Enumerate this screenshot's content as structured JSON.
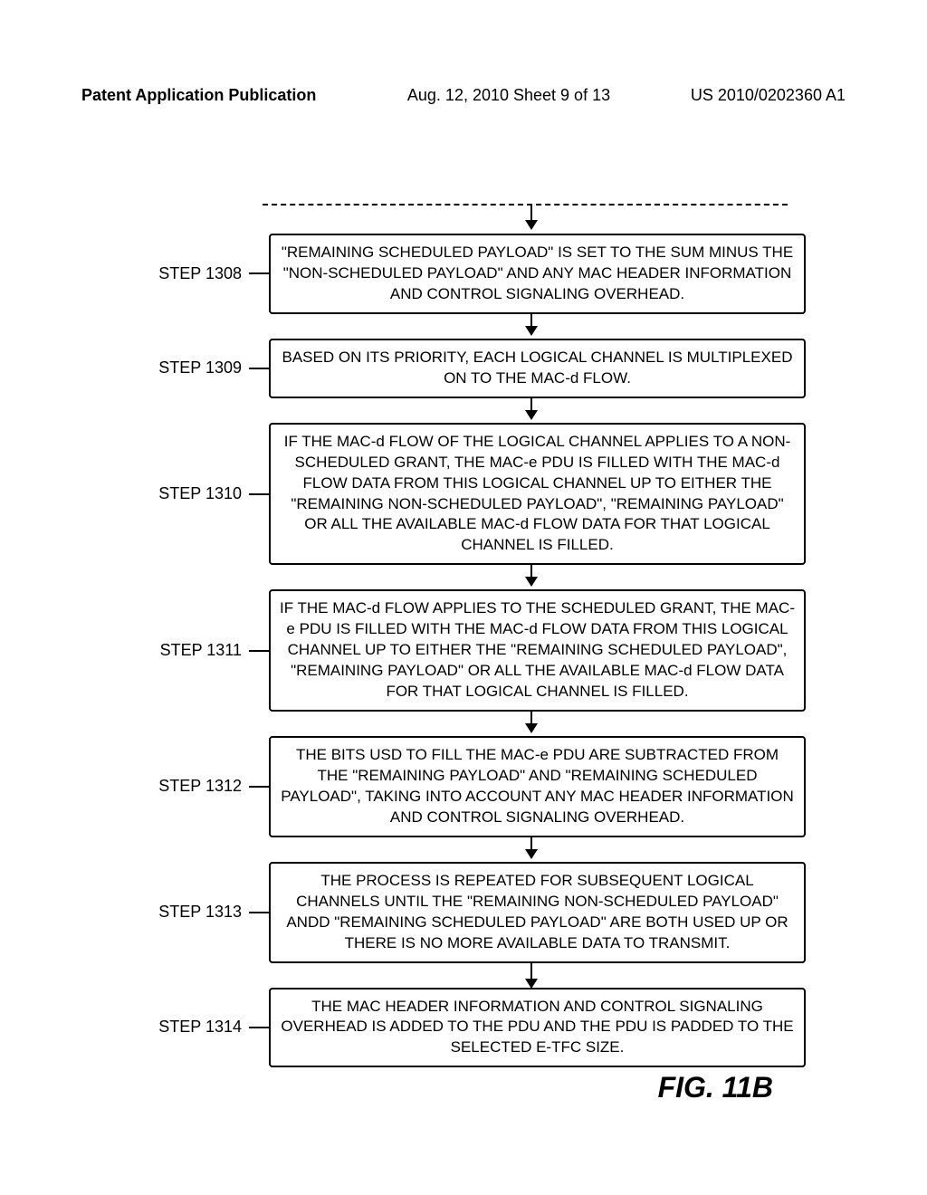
{
  "header": {
    "left": "Patent Application Publication",
    "center": "Aug. 12, 2010 Sheet 9 of 13",
    "right": "US 2010/0202360 A1"
  },
  "steps": [
    {
      "label": "STEP 1308",
      "text": "\"REMAINING SCHEDULED PAYLOAD\" IS SET TO THE SUM MINUS THE \"NON-SCHEDULED PAYLOAD\" AND ANY MAC HEADER INFORMATION AND CONTROL SIGNALING OVERHEAD."
    },
    {
      "label": "STEP 1309",
      "text": "BASED ON ITS PRIORITY, EACH LOGICAL CHANNEL IS MULTIPLEXED ON TO THE MAC-d FLOW."
    },
    {
      "label": "STEP 1310",
      "text": "IF THE MAC-d FLOW OF THE LOGICAL CHANNEL APPLIES TO A NON-SCHEDULED GRANT, THE MAC-e PDU IS FILLED WITH THE MAC-d FLOW DATA FROM THIS LOGICAL CHANNEL UP TO EITHER THE \"REMAINING NON-SCHEDULED PAYLOAD\", \"REMAINING PAYLOAD\" OR ALL THE AVAILABLE MAC-d FLOW DATA FOR THAT LOGICAL CHANNEL IS FILLED."
    },
    {
      "label": "STEP 1311",
      "text": "IF THE MAC-d FLOW APPLIES TO THE SCHEDULED GRANT, THE MAC-e PDU IS FILLED WITH THE MAC-d FLOW DATA FROM THIS LOGICAL CHANNEL UP TO EITHER THE \"REMAINING SCHEDULED PAYLOAD\", \"REMAINING PAYLOAD\" OR ALL THE AVAILABLE MAC-d FLOW DATA FOR THAT LOGICAL CHANNEL IS FILLED."
    },
    {
      "label": "STEP 1312",
      "text": "THE BITS USD TO FILL THE MAC-e PDU ARE SUBTRACTED FROM THE \"REMAINING PAYLOAD\" AND \"REMAINING SCHEDULED PAYLOAD\", TAKING INTO ACCOUNT ANY MAC HEADER INFORMATION AND CONTROL SIGNALING OVERHEAD."
    },
    {
      "label": "STEP 1313",
      "text": "THE PROCESS IS REPEATED FOR SUBSEQUENT LOGICAL CHANNELS UNTIL THE \"REMAINING NON-SCHEDULED PAYLOAD\" ANDD \"REMAINING SCHEDULED PAYLOAD\" ARE BOTH USED UP OR THERE IS NO MORE AVAILABLE DATA TO TRANSMIT."
    },
    {
      "label": "STEP 1314",
      "text": "THE MAC HEADER INFORMATION AND CONTROL SIGNALING OVERHEAD IS ADDED TO THE PDU AND THE PDU IS PADDED TO THE SELECTED E-TFC SIZE."
    }
  ],
  "figure_label": "FIG. 11B"
}
